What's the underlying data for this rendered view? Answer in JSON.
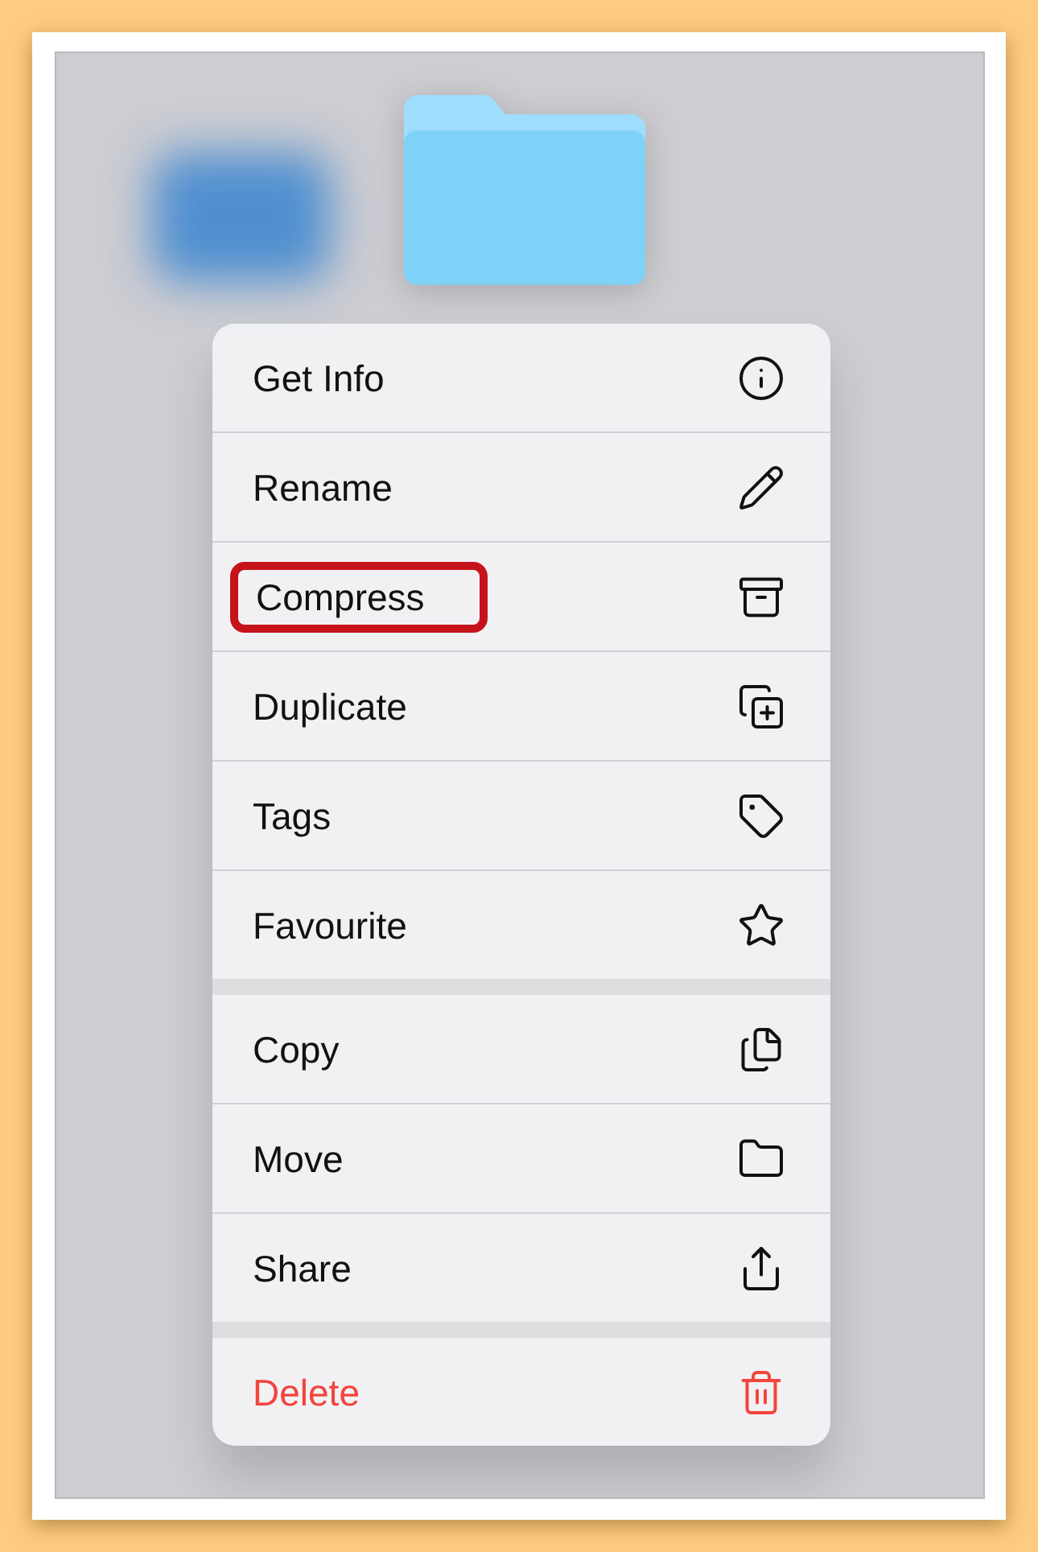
{
  "menu": {
    "groups": [
      {
        "items": [
          {
            "label": "Get Info",
            "kind": "normal",
            "highlighted": false
          },
          {
            "label": "Rename",
            "kind": "normal",
            "highlighted": false
          },
          {
            "label": "Compress",
            "kind": "normal",
            "highlighted": true
          },
          {
            "label": "Duplicate",
            "kind": "normal",
            "highlighted": false
          },
          {
            "label": "Tags",
            "kind": "normal",
            "highlighted": false
          },
          {
            "label": "Favourite",
            "kind": "normal",
            "highlighted": false
          }
        ]
      },
      {
        "items": [
          {
            "label": "Copy",
            "kind": "normal",
            "highlighted": false
          },
          {
            "label": "Move",
            "kind": "normal",
            "highlighted": false
          },
          {
            "label": "Share",
            "kind": "normal",
            "highlighted": false
          }
        ]
      },
      {
        "items": [
          {
            "label": "Delete",
            "kind": "destructive",
            "highlighted": false
          }
        ]
      }
    ]
  }
}
